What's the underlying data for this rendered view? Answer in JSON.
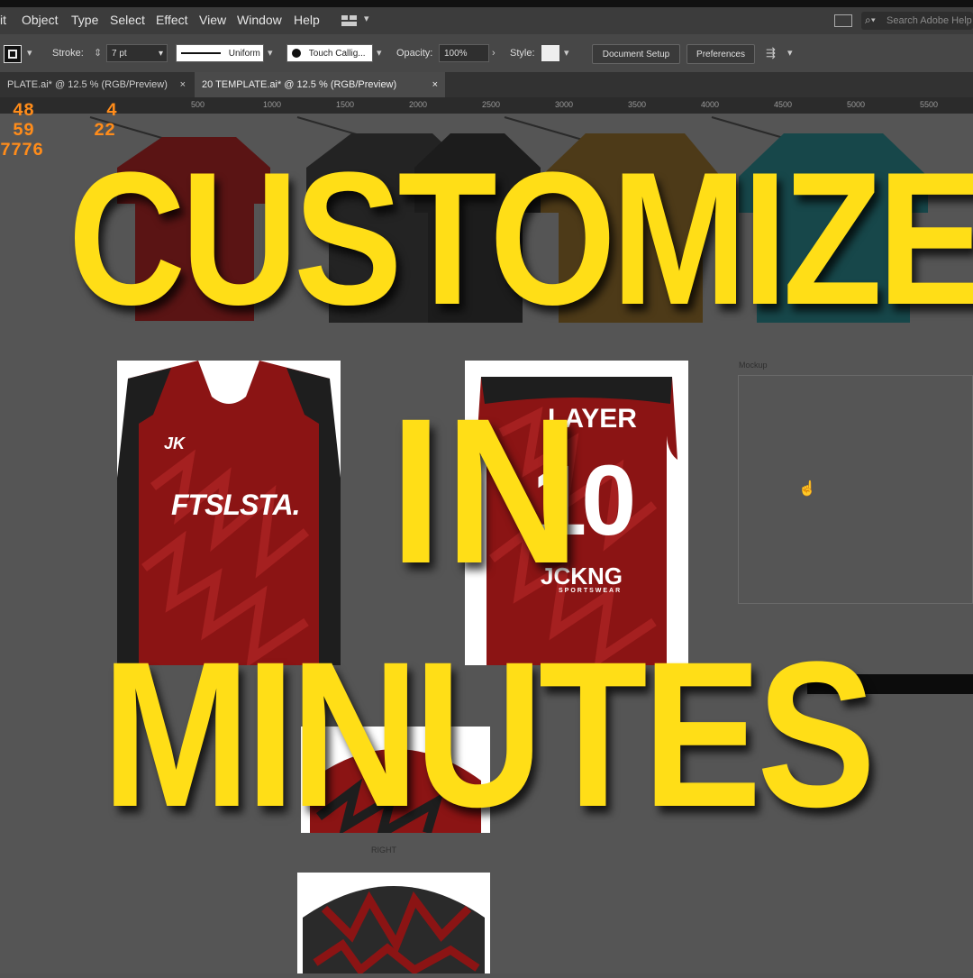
{
  "menubar": {
    "items": [
      "it",
      "Object",
      "Type",
      "Select",
      "Effect",
      "View",
      "Window",
      "Help"
    ],
    "search_placeholder": "Search Adobe Help"
  },
  "controlbar": {
    "stroke_label": "Stroke:",
    "stroke_weight": "7 pt",
    "profile": "Uniform",
    "brush": "Touch Callig...",
    "opacity_label": "Opacity:",
    "opacity_value": "100%",
    "style_label": "Style:",
    "document_setup": "Document Setup",
    "preferences": "Preferences"
  },
  "tabs": [
    {
      "label": "PLATE.ai* @ 12.5 % (RGB/Preview)"
    },
    {
      "label": "20 TEMPLATE.ai* @ 12.5 % (RGB/Preview)"
    }
  ],
  "ruler": {
    "ticks": [
      "500",
      "1000",
      "1500",
      "2000",
      "2500",
      "3000",
      "3500",
      "4000",
      "4500",
      "5000",
      "5500"
    ]
  },
  "hud": {
    "values": [
      "48",
      "4",
      "59",
      "22",
      "7776"
    ]
  },
  "artboards": {
    "mockup_label": "Mockup",
    "right_label": "RIGHT",
    "front_text": "FTSLSTA.",
    "back_name": "LAYER",
    "back_number": "10",
    "brand": "JCKNG",
    "brand_sub": "SPORTSWEAR",
    "small_logo": "JK"
  },
  "headline": {
    "line1": "CUSTOMIZE",
    "line2": "IN",
    "line3": "MINUTES"
  },
  "colors": {
    "headline": "#ffde17",
    "jersey_red": "#8b1414",
    "jersey_dark": "#1e1e1e",
    "teal": "#1f5a5c",
    "gold": "#7a5a20",
    "hud_orange": "#ff8c1a"
  }
}
